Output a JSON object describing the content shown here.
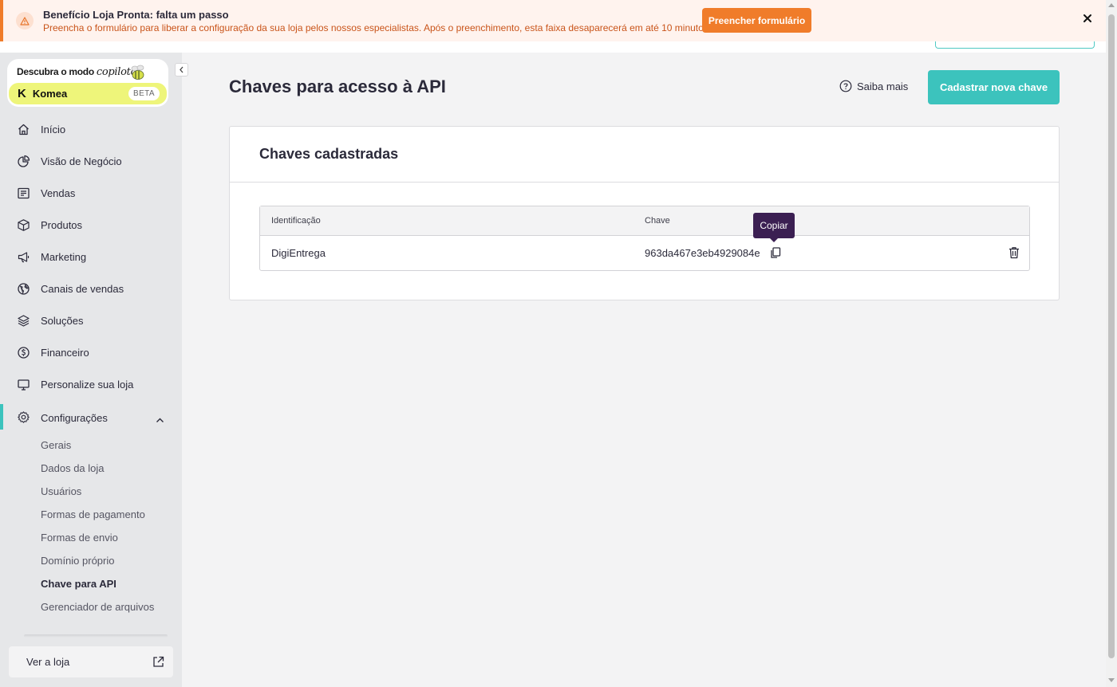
{
  "banner": {
    "title": "Benefício Loja Pronta: falta um passo",
    "description": "Preencha o formulário para liberar a configuração da sua loja pelos nossos especialistas. Após o preenchimento, esta faixa desaparecerá em até 10 minutos.",
    "button_label": "Preencher formulário",
    "accent": "#f07c2a"
  },
  "copilot": {
    "title_prefix": "Descubra o modo ",
    "title_italic": "copiloto",
    "brand": "Komea",
    "badge": "BETA"
  },
  "sidebar": {
    "items": [
      {
        "label": "Início",
        "icon": "home-icon"
      },
      {
        "label": "Visão de Negócio",
        "icon": "pie-chart-icon"
      },
      {
        "label": "Vendas",
        "icon": "receipt-icon"
      },
      {
        "label": "Produtos",
        "icon": "box-icon"
      },
      {
        "label": "Marketing",
        "icon": "megaphone-icon"
      },
      {
        "label": "Canais de vendas",
        "icon": "globe-icon"
      },
      {
        "label": "Soluções",
        "icon": "layers-icon"
      },
      {
        "label": "Financeiro",
        "icon": "dollar-circle-icon"
      },
      {
        "label": "Personalize sua loja",
        "icon": "monitor-icon"
      },
      {
        "label": "Configurações",
        "icon": "gear-icon"
      }
    ],
    "sub_items": [
      "Gerais",
      "Dados da loja",
      "Usuários",
      "Formas de pagamento",
      "Formas de envio",
      "Domínio próprio",
      "Chave para API",
      "Gerenciador de arquivos"
    ],
    "view_store": "Ver a loja"
  },
  "main": {
    "title": "Chaves para acesso à API",
    "help_link": "Saiba mais",
    "primary_button": "Cadastrar nova chave",
    "card_title": "Chaves cadastradas",
    "table": {
      "columns": [
        "Identificação",
        "Chave"
      ],
      "rows": [
        {
          "identification": "DigiEntrega",
          "key": "963da467e3eb4929084e"
        }
      ]
    },
    "tooltip": "Copiar",
    "accent": "#3cc3bd"
  }
}
